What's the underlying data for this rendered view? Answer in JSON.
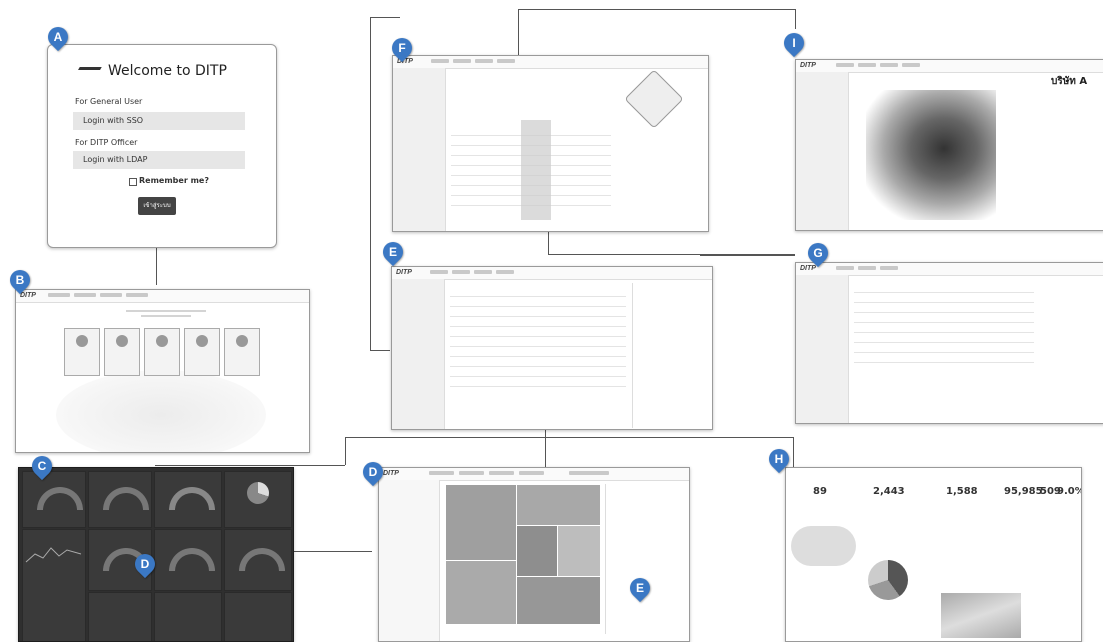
{
  "badges": {
    "a": "A",
    "b": "B",
    "c": "C",
    "d_inner": "D",
    "d": "D",
    "e": "E",
    "e_inner": "E",
    "f": "F",
    "g": "G",
    "h": "H",
    "i": "I"
  },
  "login": {
    "title": "Welcome to DITP",
    "general_label": "For General User",
    "sso_button": "Login with SSO",
    "officer_label": "For DITP Officer",
    "ldap_button": "Login with LDAP",
    "remember": "Remember me?",
    "submit": "เข้าสู่ระบบ"
  },
  "logo_text": "DITP",
  "profile": {
    "company": "บริษัท A"
  },
  "dash_h": {
    "kpi": [
      "2,443",
      "1,588",
      "95,985",
      "509",
      "9.0%",
      "89"
    ]
  },
  "colors": {
    "badge": "#3b78c4",
    "dark_panel": "#2f2f2f",
    "connector": "#555555"
  }
}
